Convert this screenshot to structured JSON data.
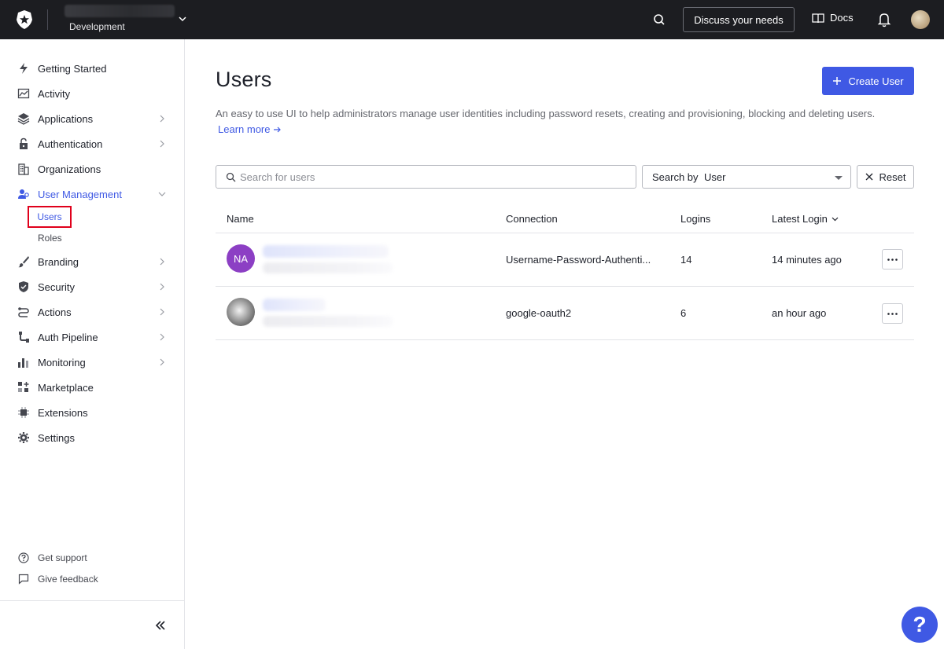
{
  "topbar": {
    "tenant_env": "Development",
    "discuss_label": "Discuss your needs",
    "docs_label": "Docs"
  },
  "sidebar": {
    "items": [
      {
        "label": "Getting Started",
        "icon": "bolt-icon"
      },
      {
        "label": "Activity",
        "icon": "activity-icon"
      },
      {
        "label": "Applications",
        "icon": "layers-icon"
      },
      {
        "label": "Authentication",
        "icon": "lock-icon"
      },
      {
        "label": "Organizations",
        "icon": "building-icon"
      },
      {
        "label": "User Management",
        "icon": "users-icon"
      },
      {
        "label": "Branding",
        "icon": "brush-icon"
      },
      {
        "label": "Security",
        "icon": "shield-icon"
      },
      {
        "label": "Actions",
        "icon": "flow-icon"
      },
      {
        "label": "Auth Pipeline",
        "icon": "pipe-icon"
      },
      {
        "label": "Monitoring",
        "icon": "bars-icon"
      },
      {
        "label": "Marketplace",
        "icon": "grid-plus-icon"
      },
      {
        "label": "Extensions",
        "icon": "chip-icon"
      },
      {
        "label": "Settings",
        "icon": "gear-icon"
      }
    ],
    "sub_items": {
      "users": "Users",
      "roles": "Roles"
    },
    "footer": {
      "support": "Get support",
      "feedback": "Give feedback"
    }
  },
  "main": {
    "title": "Users",
    "create_label": "Create User",
    "description": "An easy to use UI to help administrators manage user identities including password resets, creating and provisioning, blocking and deleting users.",
    "learn_more": "Learn more",
    "search_placeholder": "Search for users",
    "search_by_label": "Search by",
    "search_by_value": "User",
    "reset_label": "Reset",
    "columns": {
      "name": "Name",
      "connection": "Connection",
      "logins": "Logins",
      "latest_login": "Latest Login"
    },
    "rows": [
      {
        "initials": "NA",
        "connection": "Username-Password-Authenti...",
        "logins": "14",
        "latest_login": "14 minutes ago"
      },
      {
        "initials": "",
        "connection": "google-oauth2",
        "logins": "6",
        "latest_login": "an hour ago"
      }
    ]
  },
  "colors": {
    "accent": "#3f59e4",
    "topbar": "#1c1d21",
    "highlight": "#e0001b",
    "avatar_na": "#8c3fc4"
  },
  "help_label": "?"
}
